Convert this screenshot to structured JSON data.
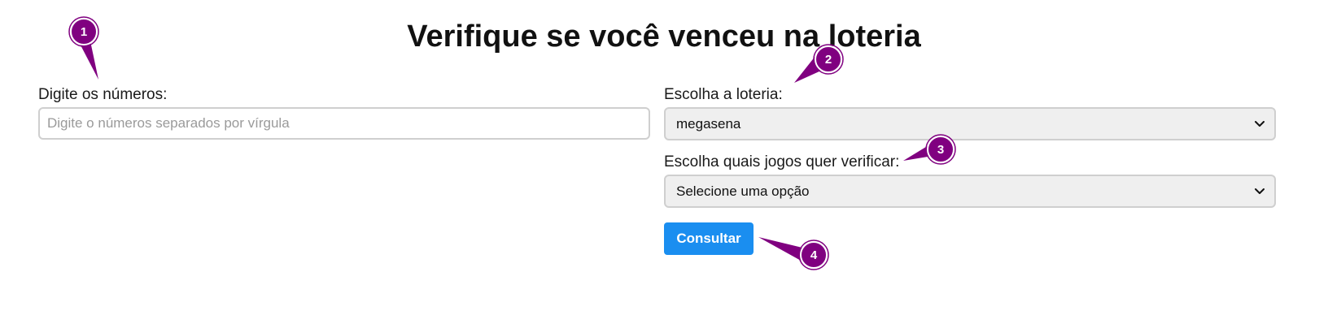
{
  "page": {
    "title": "Verifique se você venceu na loteria"
  },
  "numbers_field": {
    "label": "Digite os números:",
    "value": "",
    "placeholder": "Digite o números separados por vírgula"
  },
  "lottery_select": {
    "label": "Escolha a loteria:",
    "selected": "megasena"
  },
  "games_select": {
    "label": "Escolha quais jogos quer verificar:",
    "selected": "Selecione uma opção"
  },
  "submit_button": {
    "label": "Consultar",
    "color": "#1a8ef0"
  },
  "annotations": {
    "color": "#800080",
    "markers": [
      "1",
      "2",
      "3",
      "4"
    ]
  },
  "icons": {
    "select_arrow": "chevron-down-icon"
  }
}
